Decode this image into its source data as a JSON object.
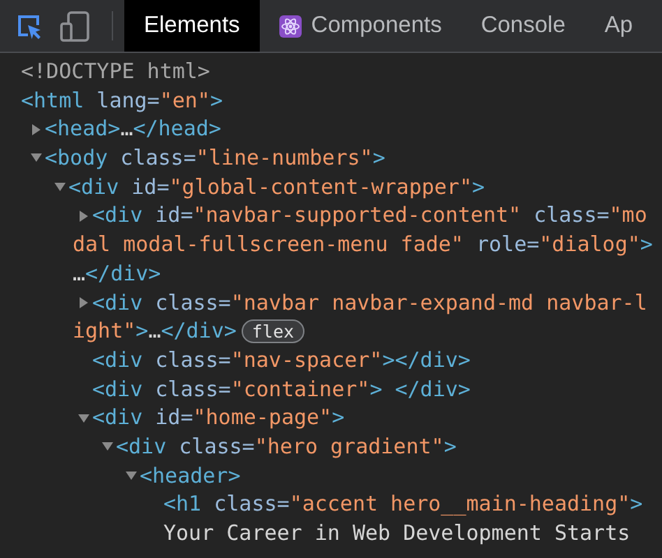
{
  "toolbar": {
    "tools": [
      {
        "kind": "inspect",
        "active": true
      },
      {
        "kind": "device",
        "active": false
      }
    ],
    "tabs": [
      {
        "label": "Elements",
        "selected": true,
        "kind": "builtin"
      },
      {
        "label": "Components",
        "selected": false,
        "kind": "extension"
      },
      {
        "label": "Console",
        "selected": false,
        "kind": "builtin"
      },
      {
        "label": "Ap",
        "selected": false,
        "kind": "builtin"
      }
    ]
  },
  "dom_tree": [
    {
      "doctype": true,
      "lines": [
        "<!DOCTYPE html>"
      ]
    },
    {
      "lines": [
        "<html lang=\"en\">"
      ],
      "children": [
        {
          "expanded": false,
          "lines": [
            "<head>…</head>"
          ]
        },
        {
          "expanded": true,
          "lines": [
            "<body class=\"line-numbers\">"
          ],
          "children": [
            {
              "expanded": true,
              "lines": [
                "<div id=\"global-content-wrapper\">"
              ],
              "children": [
                {
                  "expanded": false,
                  "lines": [
                    "<div id=\"navbar-supported-content\" class=\"mo",
                    "dal modal-fullscreen-menu fade\" role=\"dialog\">",
                    "…</div>"
                  ]
                },
                {
                  "expanded": false,
                  "lines": [
                    "<div class=\"navbar navbar-expand-md navbar-l",
                    "ight\">…</div>"
                  ],
                  "badge": "flex"
                },
                {
                  "lines": [
                    "<div class=\"nav-spacer\"></div>"
                  ]
                },
                {
                  "lines": [
                    "<div class=\"container\"> </div>"
                  ]
                },
                {
                  "expanded": true,
                  "lines": [
                    "<div id=\"home-page\">"
                  ],
                  "children": [
                    {
                      "expanded": true,
                      "lines": [
                        "<div class=\"hero gradient\">"
                      ],
                      "children": [
                        {
                          "expanded": true,
                          "lines": [
                            "<header>"
                          ],
                          "children": [
                            {
                              "lines": [
                                "<h1 class=\"accent hero__main-heading\">",
                                "Your Career in Web Development Starts"
                              ]
                            }
                          ]
                        }
                      ]
                    }
                  ]
                }
              ]
            }
          ]
        }
      ]
    }
  ]
}
